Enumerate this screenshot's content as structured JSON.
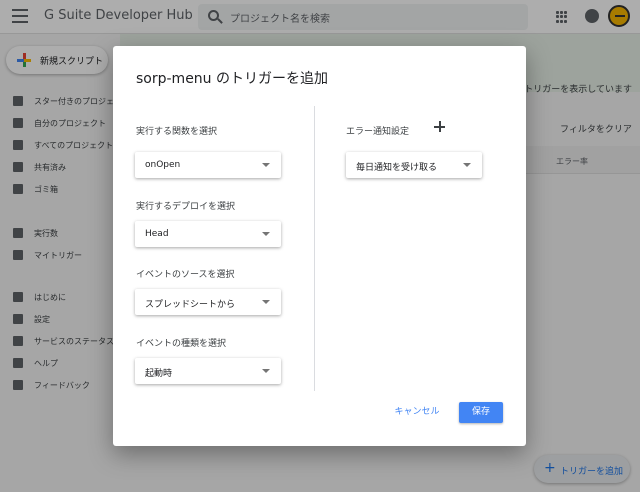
{
  "app": {
    "logo_text": "G Suite Developer Hub",
    "search_placeholder": "プロジェクト名を検索",
    "new_script_label": "新規スクリプト"
  },
  "sidebar": {
    "items": [
      {
        "label": "スター付きのプロジェクト",
        "icon": "star-icon"
      },
      {
        "label": "自分のプロジェクト",
        "icon": "folder-icon"
      },
      {
        "label": "すべてのプロジェクト",
        "icon": "folder-icon"
      },
      {
        "label": "共有済み",
        "icon": "people-icon"
      },
      {
        "label": "ゴミ箱",
        "icon": "trash-icon"
      },
      {
        "label": "実行数",
        "icon": "executions-icon"
      },
      {
        "label": "マイトリガー",
        "icon": "clock-icon"
      },
      {
        "label": "はじめに",
        "icon": "play-icon"
      },
      {
        "label": "設定",
        "icon": "gear-icon"
      },
      {
        "label": "サービスのステータス",
        "icon": "warning-icon"
      },
      {
        "label": "ヘルプ",
        "icon": "help-icon"
      },
      {
        "label": "フィードバック",
        "icon": "feedback-icon"
      }
    ]
  },
  "main": {
    "banner_text": "のトリガーを表示しています",
    "filter_clear": "フィルタをクリア",
    "column_error_rate": "エラー率",
    "add_trigger_fab": "トリガーを追加"
  },
  "dialog": {
    "title": "sorp-menu のトリガーを追加",
    "function_label": "実行する関数を選択",
    "function_value": "onOpen",
    "deployment_label": "実行するデプロイを選択",
    "deployment_value": "Head",
    "event_source_label": "イベントのソースを選択",
    "event_source_value": "スプレッドシートから",
    "event_type_label": "イベントの種類を選択",
    "event_type_value": "起動時",
    "error_notification_label": "エラー通知設定",
    "error_notification_value": "毎日通知を受け取る",
    "cancel_label": "キャンセル",
    "save_label": "保存"
  },
  "colors": {
    "primary": "#4285f4",
    "scrim": "rgba(0,0,0,0.32)"
  }
}
